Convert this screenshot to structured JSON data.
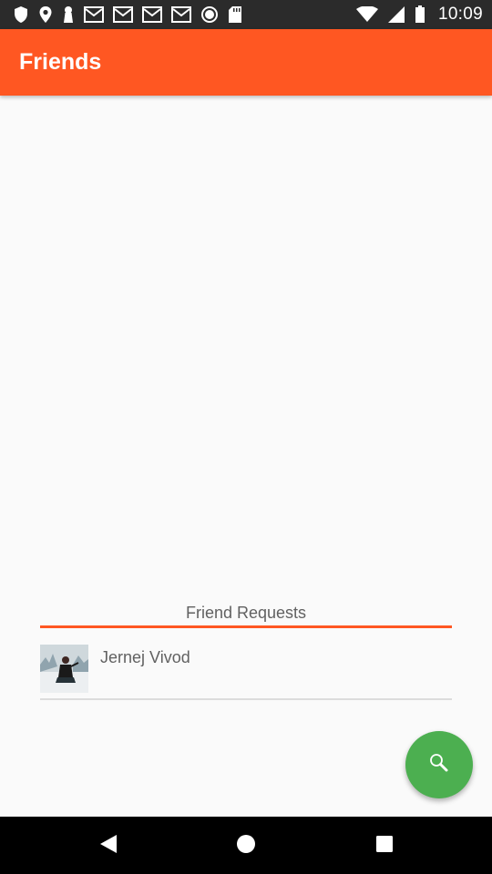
{
  "status_bar": {
    "time": "10:09",
    "left_icons": [
      "shield-icon",
      "location-icon",
      "keyhole-icon",
      "mail-icon",
      "mail-icon",
      "mail-icon",
      "mail-icon",
      "record-icon",
      "sd-card-icon"
    ],
    "right_icons": [
      "wifi-icon",
      "signal-icon",
      "battery-icon"
    ]
  },
  "app_bar": {
    "title": "Friends",
    "color": "#ff5722"
  },
  "friend_requests": {
    "header": "Friend Requests",
    "items": [
      {
        "name": "Jernej Vivod",
        "avatar": "user-photo"
      }
    ]
  },
  "fab": {
    "icon": "search-icon",
    "color": "#4caf50"
  },
  "nav_bar": {
    "buttons": [
      "back-icon",
      "home-icon",
      "recents-icon"
    ]
  }
}
